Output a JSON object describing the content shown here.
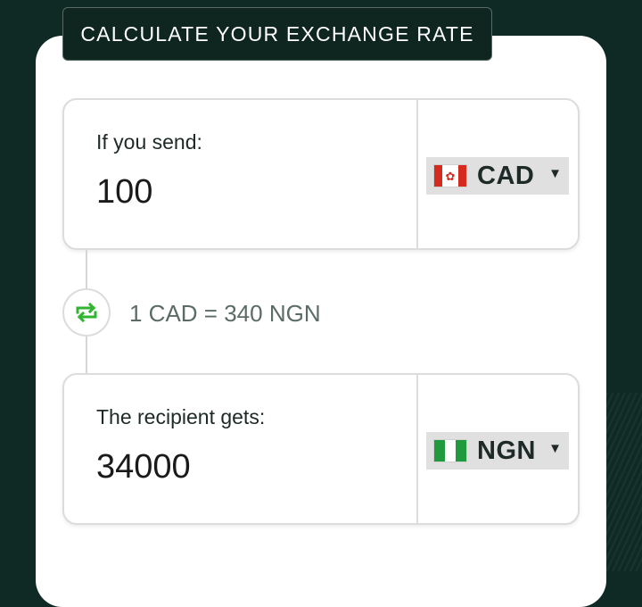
{
  "header": {
    "title": "CALCULATE YOUR EXCHANGE RATE"
  },
  "send": {
    "label": "If you send:",
    "amount": "100",
    "currency": {
      "code": "CAD",
      "flag": "canada-flag-icon"
    }
  },
  "rate": {
    "text": "1 CAD = 340 NGN",
    "icon": "swap-arrows-icon",
    "accent": "#2fb52f"
  },
  "receive": {
    "label": "The recipient gets:",
    "amount": "34000",
    "currency": {
      "code": "NGN",
      "flag": "nigeria-flag-icon"
    }
  },
  "colors": {
    "background": "#0f2a24",
    "card": "#ffffff",
    "tab": "#0f2620"
  }
}
